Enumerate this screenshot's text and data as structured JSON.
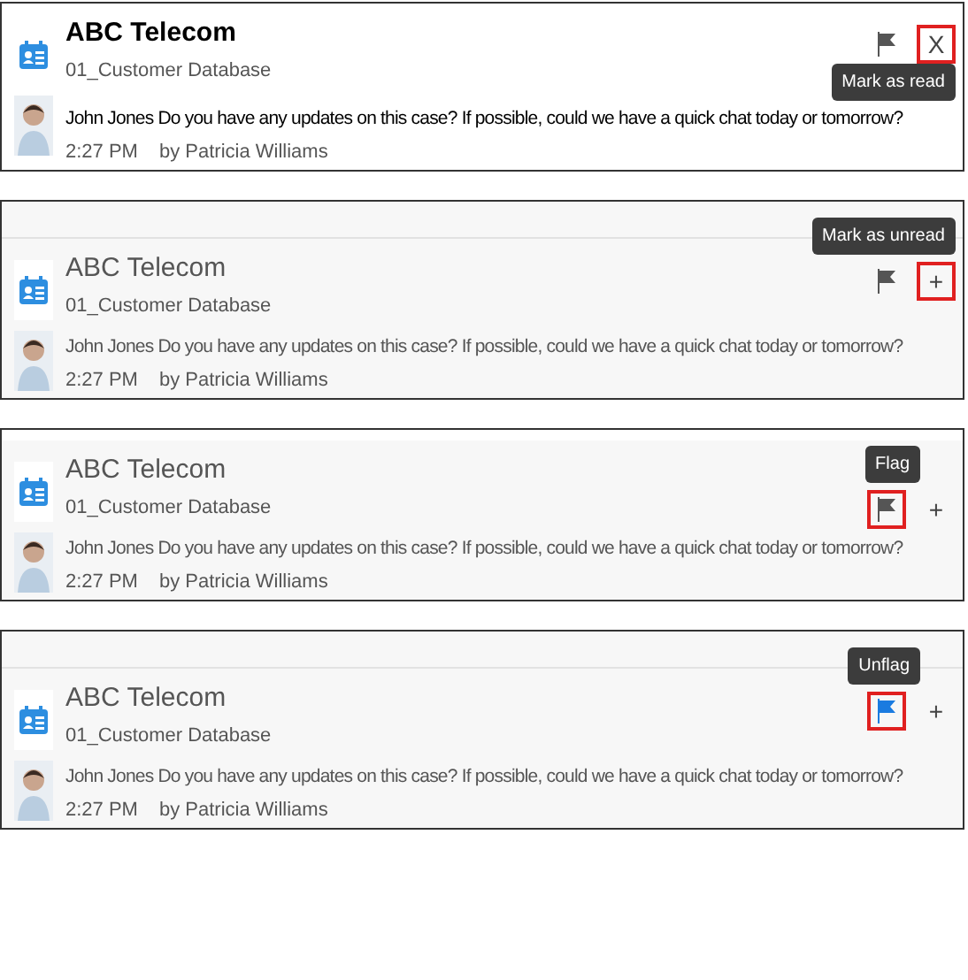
{
  "panels": [
    {
      "unread": true,
      "previous_item_visible": false,
      "flagged": false,
      "read_toggle": "X",
      "flag_highlighted": false,
      "read_highlighted": true,
      "tooltip": {
        "text": "Mark as read"
      },
      "title": "ABC Telecom",
      "subtitle": "01_Customer Database",
      "message": "John Jones Do you have any updates on this case? If possible, could we have a quick chat today or tomorrow?",
      "time": "2:27 PM",
      "author": "by Patricia Williams"
    },
    {
      "unread": false,
      "previous_item_visible": true,
      "flagged": false,
      "read_toggle": "+",
      "flag_highlighted": false,
      "read_highlighted": true,
      "tooltip": {
        "text": "Mark as unread"
      },
      "title": "ABC Telecom",
      "subtitle": "01_Customer Database",
      "message": "John Jones Do you have any updates on this case? If possible, could we have a quick chat today or tomorrow?",
      "time": "2:27 PM",
      "author": "by Patricia Williams"
    },
    {
      "unread": false,
      "previous_item_visible": false,
      "flagged": false,
      "read_toggle": "+",
      "flag_highlighted": true,
      "read_highlighted": false,
      "tooltip": {
        "text": "Flag"
      },
      "title": "ABC Telecom",
      "subtitle": "01_Customer Database",
      "message": "John Jones Do you have any updates on this case? If possible, could we have a quick chat today or tomorrow?",
      "time": "2:27 PM",
      "author": "by Patricia Williams"
    },
    {
      "unread": false,
      "previous_item_visible": true,
      "flagged": true,
      "read_toggle": "+",
      "flag_highlighted": true,
      "read_highlighted": false,
      "tooltip": {
        "text": "Unflag"
      },
      "title": "ABC Telecom",
      "subtitle": "01_Customer Database",
      "message": "John Jones Do you have any updates on this case? If possible, could we have a quick chat today or tomorrow?",
      "time": "2:27 PM",
      "author": "by Patricia Williams"
    }
  ]
}
